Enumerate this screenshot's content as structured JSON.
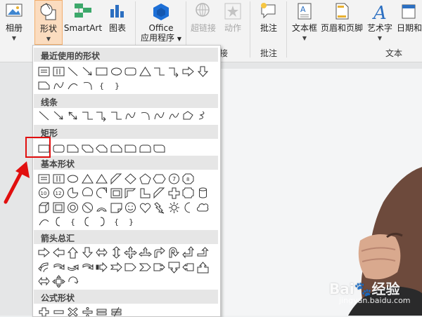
{
  "ribbon": {
    "album_label": "相册",
    "shapes_label": "形状",
    "smartart_label": "SmartArt",
    "chart_label": "图表",
    "office_label_1": "Office",
    "office_label_2": "应用程序",
    "hyperlink_label": "超链接",
    "action_label": "动作",
    "comment_label": "批注",
    "textbox_label": "文本框",
    "header_footer_label": "页眉和页脚",
    "wordart_label": "艺术字",
    "datetime_label": "日期和",
    "group_links": "接",
    "group_comments": "批注",
    "group_text": "文本"
  },
  "panel": {
    "sections": [
      "最近使用的形状",
      "线条",
      "矩形",
      "基本形状",
      "箭头总汇",
      "公式形状"
    ]
  },
  "watermark": {
    "brand": "Bai",
    "brand2": "经验",
    "sub": "jingyan.baidu.com"
  },
  "colors": {
    "selected_fill": "#fbdcbf",
    "highlight": "#e10f0f",
    "office_blue": "#1d6fd6"
  }
}
